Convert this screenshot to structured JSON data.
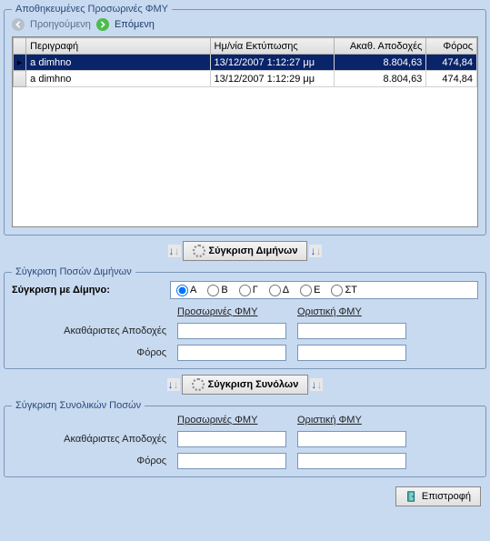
{
  "saved": {
    "legend": "Αποθηκευμένες Προσωρινές ΦΜΥ",
    "prev": "Προηγούμενη",
    "next": "Επόμενη",
    "columns": {
      "desc": "Περιγραφή",
      "date": "Ημ/νία Εκτύπωσης",
      "amount": "Ακαθ. Αποδοχές",
      "tax": "Φόρος"
    },
    "rows": [
      {
        "marker": "▸",
        "desc": "a dimhno",
        "date": "13/12/2007 1:12:27 μμ",
        "amount": "8.804,63",
        "tax": "474,84"
      },
      {
        "marker": "",
        "desc": "a dimhno",
        "date": "13/12/2007 1:12:29 μμ",
        "amount": "8.804,63",
        "tax": "474,84"
      }
    ]
  },
  "compareDim": {
    "button": "Σύγκριση Διμήνων",
    "legend": "Σύγκριση Ποσών Διμήνων",
    "label": "Σύγκριση με Δίμηνο:",
    "options": [
      "Α",
      "Β",
      "Γ",
      "Δ",
      "Ε",
      "ΣΤ"
    ],
    "colA": "Προσωρινές ΦΜΥ",
    "colB": "Οριστική ΦΜΥ",
    "row1": "Ακαθάριστες Αποδοχές",
    "row2": "Φόρος"
  },
  "compareTot": {
    "button": "Σύγκριση Συνόλων",
    "legend": "Σύγκριση Συνολικών Ποσών",
    "colA": "Προσωρινές ΦΜΥ",
    "colB": "Οριστική ΦΜΥ",
    "row1": "Ακαθάριστες Αποδοχές",
    "row2": "Φόρος"
  },
  "returnBtn": "Επιστροφή"
}
